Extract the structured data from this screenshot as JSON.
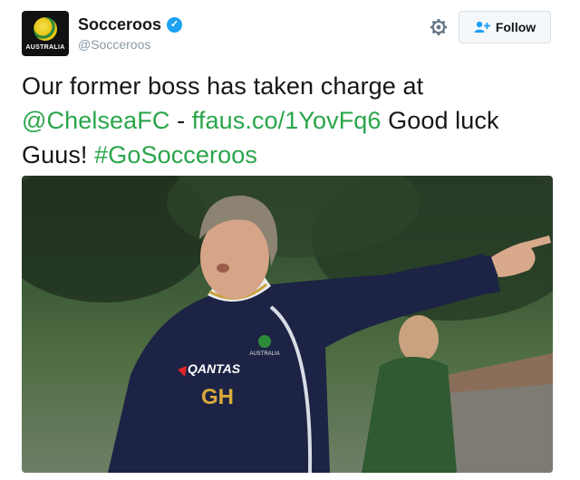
{
  "account": {
    "display_name": "Socceroos",
    "handle": "@Socceroos",
    "avatar_text": "AUSTRALIA",
    "verified": true
  },
  "follow_label": "Follow",
  "tweet": {
    "part1": "Our former boss has taken charge at ",
    "mention": "@ChelseaFC",
    "sep": " - ",
    "url": "ffaus.co/1YovFq6",
    "part2": " Good luck Guus! ",
    "hashtag": "#GoSocceroos"
  },
  "photo": {
    "shirt_sponsor": "QANTAS",
    "shirt_initials": "GH",
    "crest_text": "AUSTRALIA"
  },
  "colors": {
    "link": "#2aa54a",
    "verified": "#1da1f2",
    "shirt": "#1c2344",
    "initials": "#d9a93a"
  },
  "icons": {
    "gear": "gear-icon",
    "follow": "add-user-icon",
    "verified": "verified-badge-icon"
  }
}
